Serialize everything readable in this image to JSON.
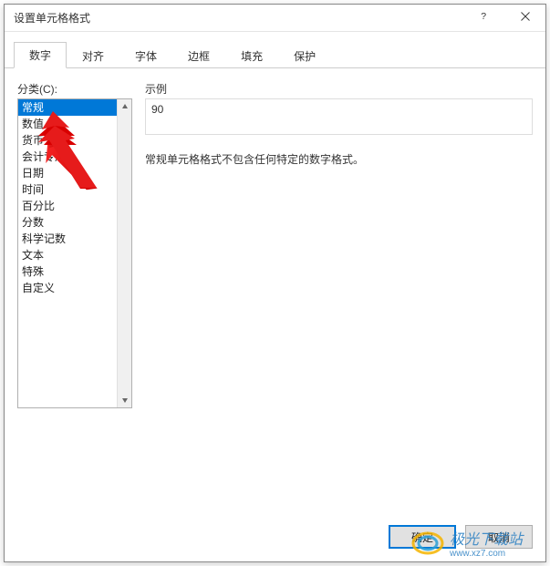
{
  "title": "设置单元格格式",
  "titlebar": {
    "help_icon": "help-icon",
    "close_icon": "close-icon"
  },
  "tabs": [
    {
      "label": "数字",
      "active": true
    },
    {
      "label": "对齐",
      "active": false
    },
    {
      "label": "字体",
      "active": false
    },
    {
      "label": "边框",
      "active": false
    },
    {
      "label": "填充",
      "active": false
    },
    {
      "label": "保护",
      "active": false
    }
  ],
  "category_label": "分类(C):",
  "categories": [
    "常规",
    "数值",
    "货币",
    "会计专用",
    "日期",
    "时间",
    "百分比",
    "分数",
    "科学记数",
    "文本",
    "特殊",
    "自定义"
  ],
  "selected_category_index": 0,
  "sample_label": "示例",
  "sample_value": "90",
  "description": "常规单元格格式不包含任何特定的数字格式。",
  "buttons": {
    "ok": "确定",
    "cancel": "取消"
  },
  "watermark": {
    "text": "极光下载站",
    "sub": "www.xz7.com"
  }
}
